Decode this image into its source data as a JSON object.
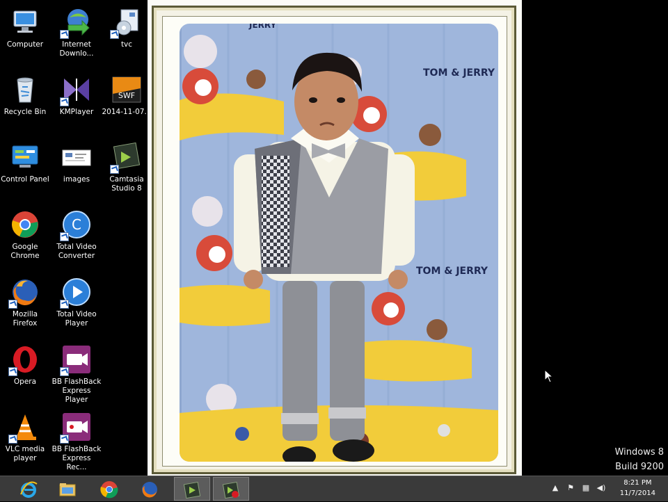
{
  "desktop": {
    "icons": [
      {
        "name": "computer",
        "label": "Computer"
      },
      {
        "name": "internet-download-manager",
        "label": "Internet Downlo..."
      },
      {
        "name": "tvc",
        "label": "tvc"
      },
      {
        "name": "recycle-bin",
        "label": "Recycle Bin"
      },
      {
        "name": "kmplayer",
        "label": "KMPlayer"
      },
      {
        "name": "swf-file",
        "label": "2014-11-07..."
      },
      {
        "name": "control-panel",
        "label": "Control Panel"
      },
      {
        "name": "images",
        "label": "images"
      },
      {
        "name": "camtasia-studio",
        "label": "Camtasia Studio 8"
      },
      {
        "name": "google-chrome",
        "label": "Google Chrome"
      },
      {
        "name": "total-video-converter",
        "label": "Total Video Converter"
      },
      {
        "name": "mozilla-firefox",
        "label": "Mozilla Firefox"
      },
      {
        "name": "total-video-player",
        "label": "Total Video Player"
      },
      {
        "name": "opera",
        "label": "Opera"
      },
      {
        "name": "bb-flashback-player",
        "label": "BB FlashBack Express Player"
      },
      {
        "name": "vlc-media-player",
        "label": "VLC media player"
      },
      {
        "name": "bb-flashback-recorder",
        "label": "BB FlashBack Express Rec..."
      }
    ],
    "swf_badge": "SWF",
    "watermark": {
      "line1": "Windows 8",
      "line2": "Build 9200"
    }
  },
  "photo": {
    "backdrop_text": [
      "TOM & JERRY",
      "TOM & JERRY",
      "TOM & JERRY",
      "JERRY"
    ]
  },
  "taskbar": {
    "pinned": [
      {
        "name": "internet-explorer",
        "active": false
      },
      {
        "name": "file-explorer",
        "active": false
      },
      {
        "name": "google-chrome",
        "active": false
      },
      {
        "name": "mozilla-firefox",
        "active": false
      },
      {
        "name": "camtasia-studio",
        "active": true
      },
      {
        "name": "camtasia-recorder",
        "active": true
      }
    ],
    "clock": {
      "time": "8:21 PM",
      "date": "11/7/2014"
    }
  },
  "colors": {
    "desktop_bg": "#000000",
    "taskbar_bg": "#3a3a3a",
    "backdrop_blue": "#9fb6dc",
    "floor_yellow": "#f2cc3a"
  }
}
